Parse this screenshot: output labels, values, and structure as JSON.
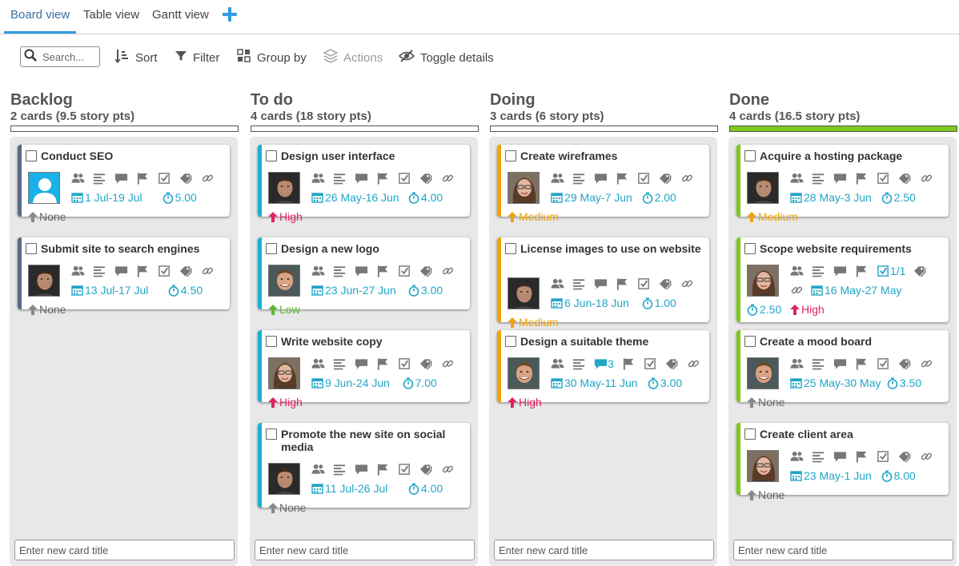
{
  "tabs": [
    {
      "label": "Board view",
      "active": true
    },
    {
      "label": "Table view",
      "active": false
    },
    {
      "label": "Gantt view",
      "active": false
    }
  ],
  "toolbar": {
    "search_placeholder": "Search...",
    "sort": "Sort",
    "filter": "Filter",
    "group_by": "Group by",
    "actions": "Actions",
    "toggle_details": "Toggle details"
  },
  "colors": {
    "accent": "#2f9be0",
    "date_text": "#20a6c8",
    "high": "#e0245e",
    "medium": "#f0a30a",
    "low": "#5cb82e",
    "none": "#666666",
    "backlog": "#5a6a86",
    "todo": "#1ab0d0",
    "doing": "#f0a30a",
    "done": "#7dc91a"
  },
  "columns": [
    {
      "title": "Backlog",
      "subtitle": "2 cards (9.5 story pts)",
      "progress": 0,
      "new_card_placeholder": "Enter new card title",
      "cards": [
        {
          "title": "Conduct SEO",
          "dates": "1 Jul-19 Jul",
          "estimate": "5.00",
          "priority": "None",
          "avatar": "placeholder"
        },
        {
          "title": "Submit site to search engines",
          "dates": "13 Jul-17 Jul",
          "estimate": "4.50",
          "priority": "None",
          "avatar": "man-dark"
        }
      ]
    },
    {
      "title": "To do",
      "subtitle": "4 cards (18 story pts)",
      "progress": 0,
      "new_card_placeholder": "Enter new card title",
      "cards": [
        {
          "title": "Design user interface",
          "dates": "26 May-16 Jun",
          "estimate": "4.00",
          "priority": "High",
          "avatar": "man-dark"
        },
        {
          "title": "Design a new logo",
          "dates": "23 Jun-27 Jun",
          "estimate": "3.00",
          "priority": "Low",
          "avatar": "man-smile"
        },
        {
          "title": "Write website copy",
          "dates": "9 Jun-24 Jun",
          "estimate": "7.00",
          "priority": "High",
          "avatar": "woman"
        },
        {
          "title": "Promote the new site on social media",
          "dates": "11 Jul-26 Jul",
          "estimate": "4.00",
          "priority": "None",
          "avatar": "man-dark"
        }
      ]
    },
    {
      "title": "Doing",
      "subtitle": "3 cards (6 story pts)",
      "progress": 0,
      "new_card_placeholder": "Enter new card title",
      "cards": [
        {
          "title": "Create wireframes",
          "dates": "29 May-7 Jun",
          "estimate": "2.00",
          "priority": "Medium",
          "avatar": "woman"
        },
        {
          "title": "License images to use on website",
          "dates": "6 Jun-18 Jun",
          "estimate": "1.00",
          "priority": "Medium",
          "avatar": "man-dark"
        },
        {
          "title": "Design a suitable theme",
          "dates": "30 May-11 Jun",
          "estimate": "3.00",
          "priority": "High",
          "avatar": "man-smile",
          "comments": "3"
        }
      ]
    },
    {
      "title": "Done",
      "subtitle": "4 cards (16.5 story pts)",
      "progress": 1,
      "new_card_placeholder": "Enter new card title",
      "cards": [
        {
          "title": "Acquire a hosting package",
          "dates": "28 May-3 Jun",
          "estimate": "2.50",
          "priority": "Medium",
          "avatar": "man-dark"
        },
        {
          "title": "Scope website requirements",
          "dates": "16 May-27 May",
          "estimate": "2.50",
          "priority": "High",
          "avatar": "woman",
          "checklist": "1/1"
        },
        {
          "title": "Create a mood board",
          "dates": "25 May-30 May",
          "estimate": "3.50",
          "priority": "None",
          "avatar": "man-smile"
        },
        {
          "title": "Create client area",
          "dates": "23 May-1 Jun",
          "estimate": "8.00",
          "priority": "None",
          "avatar": "woman"
        }
      ]
    }
  ]
}
